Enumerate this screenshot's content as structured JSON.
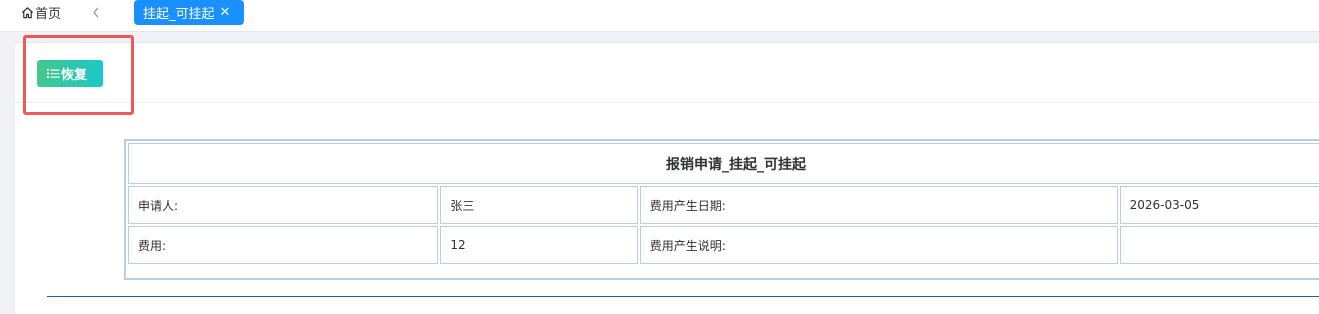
{
  "tabs": {
    "home_label": "首页",
    "active_label": "挂起_可挂起",
    "close_glyph": "✕"
  },
  "toolbar": {
    "restore_label": "恢复"
  },
  "form": {
    "title": "报销申请_挂起_可挂起",
    "rows": [
      [
        "申请人:",
        "张三",
        "费用产生日期:",
        "2026-03-05"
      ],
      [
        "费用:",
        "12",
        "费用产生说明:",
        ""
      ]
    ]
  },
  "colors": {
    "tab_active": "#1890ff",
    "button_gradient_start": "#43c88a",
    "button_gradient_end": "#1bc8c9",
    "highlight_border": "#f0595a",
    "table_border": "#b9cde6"
  }
}
